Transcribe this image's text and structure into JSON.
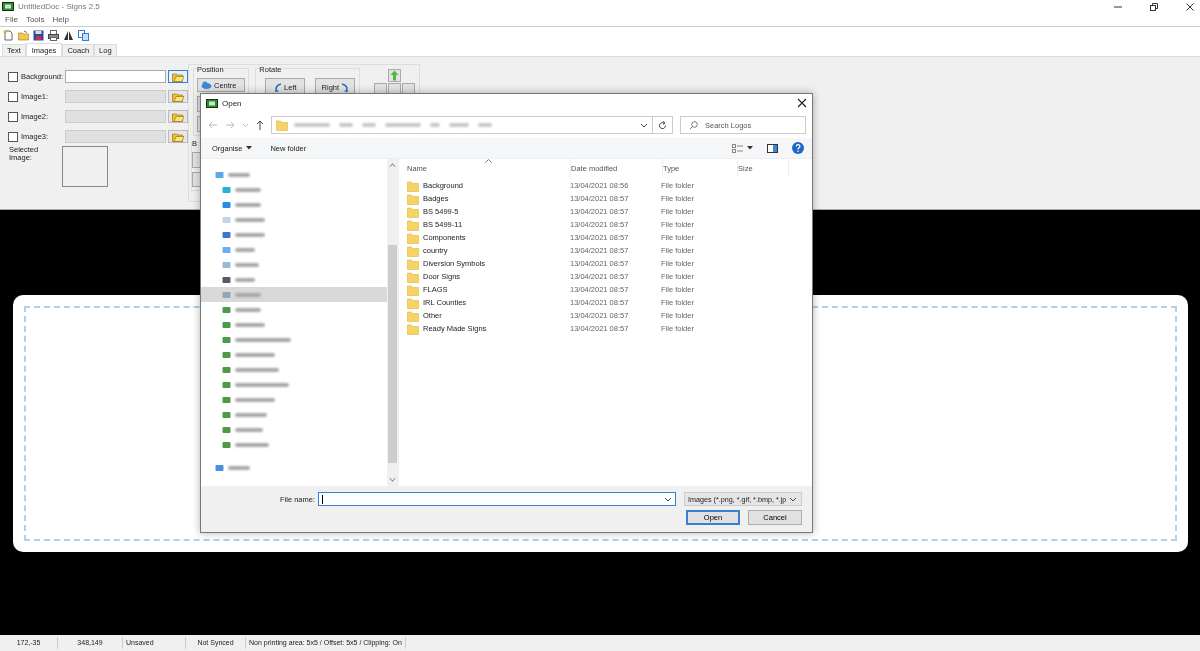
{
  "window": {
    "title": "UntitledDoc - Signs 2.5"
  },
  "menu": [
    "File",
    "Tools",
    "Help"
  ],
  "tabs": [
    {
      "label": "Text",
      "selected": false
    },
    {
      "label": "Images",
      "selected": true
    },
    {
      "label": "Coach",
      "selected": false
    },
    {
      "label": "Log",
      "selected": false
    }
  ],
  "image_rows": [
    {
      "label": "Background:",
      "checked": false,
      "disabled": false
    },
    {
      "label": "Image1:",
      "checked": false,
      "disabled": true
    },
    {
      "label": "Image2:",
      "checked": false,
      "disabled": true
    },
    {
      "label": "Image3:",
      "checked": false,
      "disabled": true
    }
  ],
  "selected_image_label": "Selected Image:",
  "position": {
    "title": "Position",
    "button": "Centre"
  },
  "rotate": {
    "title": "Rotate",
    "buttons": [
      "Left",
      "Right"
    ]
  },
  "group_label": "B",
  "dialog": {
    "title": "Open",
    "search": {
      "placeholder": "Search Logos"
    },
    "commands": [
      "Organise",
      "New folder"
    ],
    "nav_tree": [
      {
        "kind": "pc",
        "selected": false,
        "children": [
          {
            "kind": "cube",
            "selected": false
          },
          {
            "kind": "desktop",
            "selected": false
          },
          {
            "kind": "document",
            "selected": false
          },
          {
            "kind": "download",
            "selected": false
          },
          {
            "kind": "music",
            "selected": false
          },
          {
            "kind": "pictures",
            "selected": false
          },
          {
            "kind": "video",
            "selected": false
          },
          {
            "kind": "disk",
            "selected": true
          },
          {
            "kind": "drive",
            "selected": false
          },
          {
            "kind": "drive",
            "selected": false
          },
          {
            "kind": "drive",
            "selected": false
          },
          {
            "kind": "drive",
            "selected": false
          },
          {
            "kind": "drive",
            "selected": false
          },
          {
            "kind": "drive",
            "selected": false
          },
          {
            "kind": "drive",
            "selected": false
          },
          {
            "kind": "drive",
            "selected": false
          },
          {
            "kind": "drive",
            "selected": false
          },
          {
            "kind": "drive",
            "selected": false
          }
        ]
      },
      {
        "kind": "network",
        "selected": false
      }
    ],
    "columns": [
      "Name",
      "Date modified",
      "Type",
      "Size"
    ],
    "rows": [
      {
        "name": "Background",
        "date": "13/04/2021 08:56",
        "type": "File folder"
      },
      {
        "name": "Badges",
        "date": "13/04/2021 08:57",
        "type": "File folder"
      },
      {
        "name": "BS 5499-5",
        "date": "13/04/2021 08:57",
        "type": "File folder"
      },
      {
        "name": "BS 5499-11",
        "date": "13/04/2021 08:57",
        "type": "File folder"
      },
      {
        "name": "Components",
        "date": "13/04/2021 08:57",
        "type": "File folder"
      },
      {
        "name": "country",
        "date": "13/04/2021 08:57",
        "type": "File folder"
      },
      {
        "name": "Diversion Symbols",
        "date": "13/04/2021 08:57",
        "type": "File folder"
      },
      {
        "name": "Door Signs",
        "date": "13/04/2021 08:57",
        "type": "File folder"
      },
      {
        "name": "FLAGS",
        "date": "13/04/2021 08:57",
        "type": "File folder"
      },
      {
        "name": "IRL Counties",
        "date": "13/04/2021 08:57",
        "type": "File folder"
      },
      {
        "name": "Other",
        "date": "13/04/2021 08:57",
        "type": "File folder"
      },
      {
        "name": "Ready Made Signs",
        "date": "13/04/2021 08:57",
        "type": "File folder"
      }
    ],
    "file_name_label": "File name:",
    "filter": "Images (*.png, *.gif, *.bmp, *.jp",
    "buttons": [
      "Open",
      "Cancel"
    ]
  },
  "status_bar": [
    "172,-35",
    "348,149",
    "Unsaved",
    "Not Synced",
    "Non printing area: 5x5 / Offset: 5x5 / Clipping: On"
  ]
}
